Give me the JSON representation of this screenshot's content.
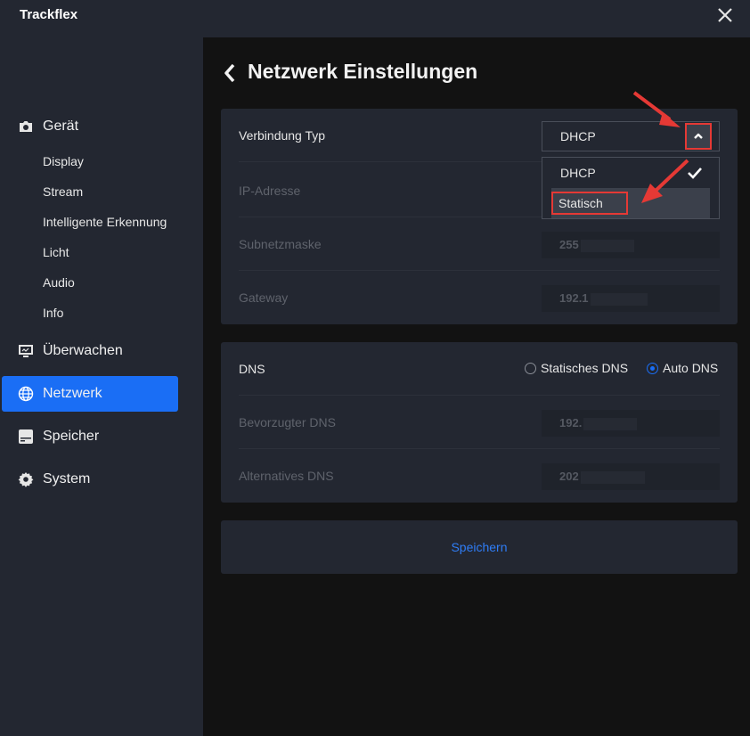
{
  "app": {
    "title": "Trackflex"
  },
  "sidebar": {
    "items": [
      {
        "label": "Gerät",
        "icon": "camera-icon"
      },
      {
        "label": "Überwachen",
        "icon": "monitor-icon"
      },
      {
        "label": "Netzwerk",
        "icon": "globe-icon",
        "active": true
      },
      {
        "label": "Speicher",
        "icon": "storage-icon"
      },
      {
        "label": "System",
        "icon": "gear-icon"
      }
    ],
    "subitems": [
      "Display",
      "Stream",
      "Intelligente Erkennung",
      "Licht",
      "Audio",
      "Info"
    ]
  },
  "page": {
    "title": "Netzwerk Einstellungen"
  },
  "network": {
    "connection_type_label": "Verbindung Typ",
    "connection_type_value": "DHCP",
    "dropdown_options": [
      {
        "label": "DHCP",
        "selected": true
      },
      {
        "label": "Statisch",
        "highlighted": true
      }
    ],
    "ip_label": "IP-Adresse",
    "subnet_label": "Subnetzmaske",
    "subnet_value": "255",
    "gateway_label": "Gateway",
    "gateway_value": "192.1"
  },
  "dns": {
    "label": "DNS",
    "option_static": "Statisches DNS",
    "option_auto": "Auto DNS",
    "selected": "Auto DNS",
    "preferred_label": "Bevorzugter DNS",
    "preferred_value": "192.",
    "alternative_label": "Alternatives DNS",
    "alternative_value": "202"
  },
  "actions": {
    "save_label": "Speichern"
  },
  "colors": {
    "accent": "#1a6ef5",
    "annotation": "#e53935",
    "panel": "#232731",
    "background": "#121212"
  }
}
